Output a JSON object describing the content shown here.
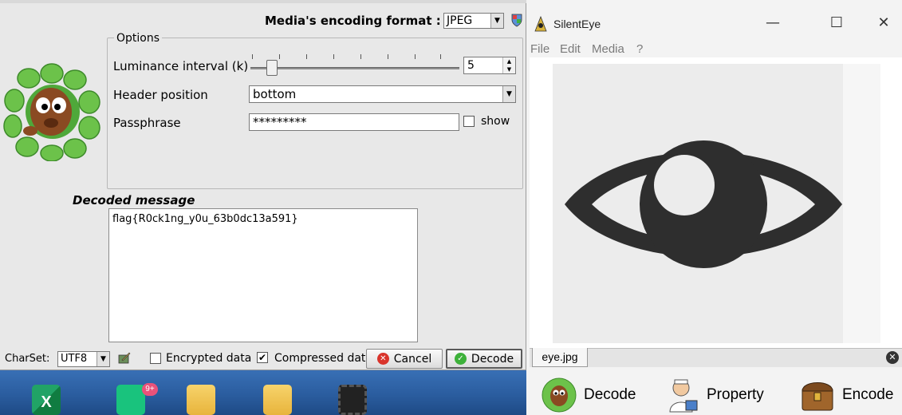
{
  "decode_dialog": {
    "format_label": "Media's encoding format :",
    "format_value": "JPEG",
    "options_title": "Options",
    "luminance_label": "Luminance interval (k)",
    "luminance_value": "5",
    "luminance_level_fraction": 0.07,
    "header_position_label": "Header position",
    "header_position_value": "bottom",
    "passphrase_label": "Passphrase",
    "passphrase_value": "*********",
    "show_label": "show",
    "decoded_title": "Decoded message",
    "decoded_text": "flag{R0ck1ng_y0u_63b0dc13a591}",
    "charset_label": "CharSet:",
    "charset_value": "UTF8",
    "encrypted_label": "Encrypted data",
    "compressed_label": "Compressed dat",
    "cancel_label": "Cancel",
    "decode_label": "Decode"
  },
  "taskbar": {
    "badge": "9+",
    "excel_glyph": "X"
  },
  "silenteye": {
    "title": "SilentEye",
    "menu": [
      "File",
      "Edit",
      "Media",
      "?"
    ],
    "tab_label": "eye.jpg",
    "actions": [
      "Decode",
      "Property",
      "Encode"
    ]
  },
  "colors": {
    "eye": "#2e2e2e",
    "image_bg": "#ececec",
    "cancel_icon": "#d9342b",
    "decode_icon": "#3db13a"
  }
}
